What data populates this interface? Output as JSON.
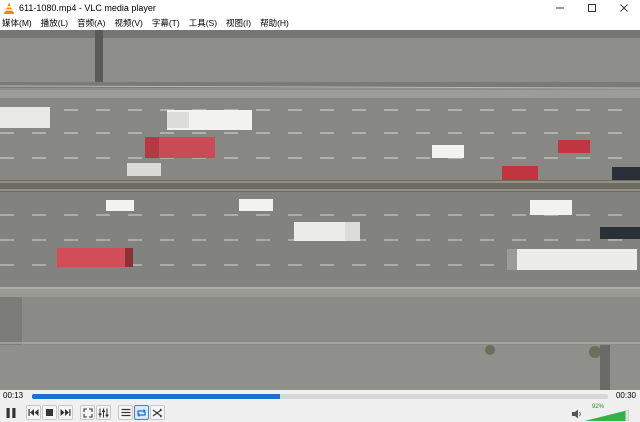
{
  "window": {
    "title": "611-1080.mp4 - VLC media player",
    "controls": [
      "minimize",
      "maximize",
      "close"
    ]
  },
  "menu": {
    "items": [
      {
        "label": "媒体(M)"
      },
      {
        "label": "播放(L)"
      },
      {
        "label": "音频(A)"
      },
      {
        "label": "视频(V)"
      },
      {
        "label": "字幕(T)"
      },
      {
        "label": "工具(S)"
      },
      {
        "label": "视图(I)"
      },
      {
        "label": "帮助(H)"
      }
    ]
  },
  "video": {
    "description_icon": "video-frame"
  },
  "playback": {
    "elapsed": "00:13",
    "total": "00:30",
    "progress_fraction": 0.43
  },
  "controls": {
    "buttons": [
      {
        "name": "pause-button",
        "icon": "pause-icon"
      },
      {
        "name": "previous-button",
        "icon": "previous-icon"
      },
      {
        "name": "stop-button",
        "icon": "stop-icon"
      },
      {
        "name": "next-button",
        "icon": "next-icon"
      },
      {
        "name": "fullscreen-button",
        "icon": "fullscreen-icon"
      },
      {
        "name": "extended-settings-button",
        "icon": "equalizer-icon"
      },
      {
        "name": "playlist-button",
        "icon": "playlist-icon"
      },
      {
        "name": "loop-button",
        "icon": "loop-icon",
        "active": true
      },
      {
        "name": "shuffle-button",
        "icon": "shuffle-icon"
      }
    ]
  },
  "volume": {
    "percent_label": "92%",
    "level": 0.92,
    "icon": "speaker-icon"
  },
  "colors": {
    "accent": "#1f6fd0",
    "volume_green": "#2fb34a",
    "titlebar": "#ffffff"
  }
}
